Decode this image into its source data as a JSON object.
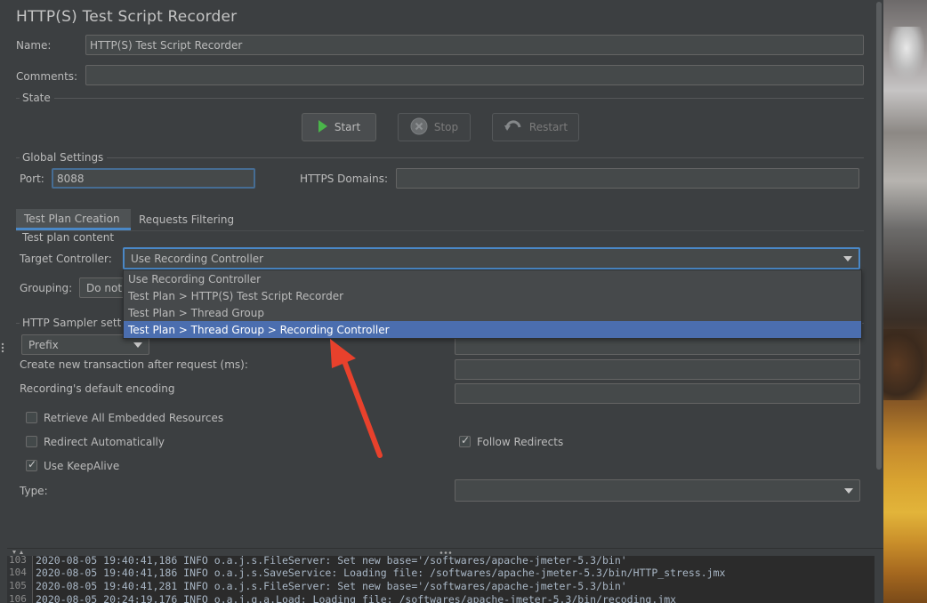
{
  "title": "HTTP(S) Test Script Recorder",
  "name": {
    "label": "Name:",
    "value": "HTTP(S) Test Script Recorder"
  },
  "comments": {
    "label": "Comments:",
    "value": ""
  },
  "state": {
    "section_title": "State",
    "start_label": "Start",
    "stop_label": "Stop",
    "restart_label": "Restart"
  },
  "global_settings": {
    "section_title": "Global Settings",
    "port_label": "Port:",
    "port_value": "8088",
    "https_domains_label": "HTTPS Domains:",
    "https_domains_value": ""
  },
  "tabs": [
    {
      "label": "Test Plan Creation",
      "active": true
    },
    {
      "label": "Requests Filtering",
      "active": false
    }
  ],
  "test_plan": {
    "section_title": "Test plan content",
    "target_controller_label": "Target Controller:",
    "target_controller_value": "Use Recording Controller",
    "grouping_label": "Grouping:",
    "grouping_value": "Do not"
  },
  "dropdown": {
    "options": [
      "Use Recording Controller",
      "Test Plan > HTTP(S) Test Script Recorder",
      "Test Plan > Thread Group",
      "Test Plan > Thread Group > Recording Controller"
    ],
    "selected_index": 3
  },
  "http_sampler": {
    "section_title": "HTTP Sampler sett",
    "naming_value": "Prefix",
    "transaction_label": "Create new transaction after request (ms):",
    "encoding_label": "Recording's default encoding",
    "retrieve_label": "Retrieve All Embedded Resources",
    "retrieve_checked": false,
    "redirect_label": "Redirect Automatically",
    "redirect_checked": false,
    "follow_label": "Follow Redirects",
    "follow_checked": true,
    "keepalive_label": "Use KeepAlive",
    "keepalive_checked": true,
    "type_label": "Type:",
    "type_value": ""
  },
  "log": {
    "lines": [
      {
        "num": "103",
        "text": "2020-08-05 19:40:41,186 INFO o.a.j.s.FileServer: Set new base='/softwares/apache-jmeter-5.3/bin'"
      },
      {
        "num": "104",
        "text": "2020-08-05 19:40:41,186 INFO o.a.j.s.SaveService: Loading file: /softwares/apache-jmeter-5.3/bin/HTTP_stress.jmx"
      },
      {
        "num": "105",
        "text": "2020-08-05 19:40:41,281 INFO o.a.j.s.FileServer: Set new base='/softwares/apache-jmeter-5.3/bin'"
      },
      {
        "num": "106",
        "text": "2020-08-05 20:24:19,176 INFO o.a.j.g.a.Load: Loading file: /softwares/apache-jmeter-5.3/bin/recoding.jmx"
      }
    ]
  },
  "colors": {
    "panel_bg": "#3c3f41",
    "selection": "#4b6eaf",
    "accent_tab": "#4a88c7",
    "annotation_arrow": "#e8412c",
    "start_icon": "#4ab54a"
  }
}
